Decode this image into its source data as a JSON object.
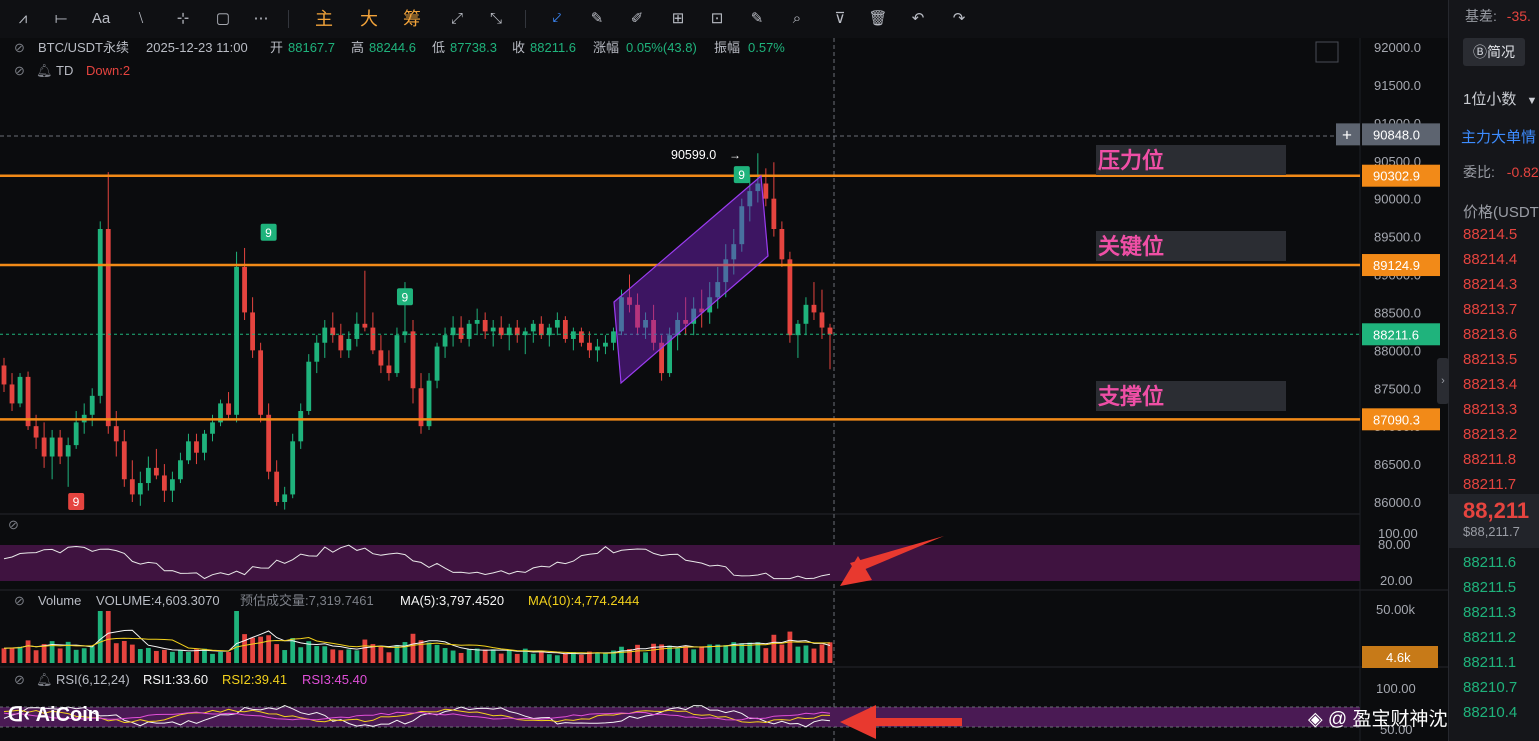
{
  "toolbar": {
    "icons": [
      "wave-line-icon",
      "horizontal-line-icon",
      "text-aa-icon",
      "strike-line-icon",
      "cross-line-icon",
      "rectangle-icon",
      "more-dots-icon"
    ],
    "glyphs": [
      "⩘",
      "⟝",
      "Aa",
      "⧵",
      "⊹",
      "▢",
      "⋯"
    ],
    "cn_buttons": [
      "主",
      "大",
      "筹"
    ],
    "tool_glyphs": [
      "⤢",
      "⤡",
      "⤦",
      "✎",
      "✐",
      "⊞",
      "⊡",
      "✎",
      "⌕",
      "⊽",
      "🗑",
      "↶",
      "↷"
    ]
  },
  "header": {
    "symbol": "BTC/USDT永续",
    "datetime": "2025-12-23 11:00",
    "open_label": "开",
    "open": "88167.7",
    "high_label": "高",
    "high": "88244.6",
    "low_label": "低",
    "low": "87738.3",
    "close_label": "收",
    "close": "88211.6",
    "change_label": "涨幅",
    "change": "0.05%(43.8)",
    "amp_label": "振幅",
    "amp": "0.57%",
    "td_label": "TD",
    "td_down": "Down:2"
  },
  "annotations": {
    "resistance": "压力位",
    "key": "关键位",
    "support": "支撑位",
    "peak": "90599.0"
  },
  "volume_header": {
    "title": "Volume",
    "volume": "VOLUME:4,603.3070",
    "forecast": "预估成交量:7,319.7461",
    "ma5": "MA(5):3,797.4520",
    "ma10": "MA(10):4,774.2444"
  },
  "rsi_header": {
    "title": "RSI(6,12,24)",
    "rsi1": "RSI1:33.60",
    "rsi2": "RSI2:39.41",
    "rsi3": "RSI3:45.40"
  },
  "price_axis": [
    "92000.0",
    "91500.0",
    "91000.0",
    "90500.0",
    "90000.0",
    "89500.0",
    "89000.0",
    "88500.0",
    "88000.0",
    "87500.0",
    "87000.0",
    "86500.0",
    "86000.0"
  ],
  "level_tags": [
    "90848.0",
    "90302.9",
    "89124.9",
    "88211.6",
    "87090.3"
  ],
  "osc_axis": [
    "100.00",
    "80.00",
    "20.00"
  ],
  "vol_axis": [
    "50.00k",
    "4.6k"
  ],
  "rsi_axis": [
    "100.00",
    "50.00"
  ],
  "td_markers": [
    "9",
    "9",
    "9",
    "9"
  ],
  "watermark": {
    "brand": "AiCoin",
    "author": "@ 盈宝财神沈万三"
  },
  "sidebar": {
    "basis_label": "基差:",
    "basis_value": "-35.",
    "brief": "简况",
    "decimals": "1位小数",
    "main_force": "主力大单情",
    "ratio_label": "委比:",
    "ratio_value": "-0.82",
    "price_header": "价格(USDT",
    "asks": [
      "88214.5",
      "88214.4",
      "88214.3",
      "88213.7",
      "88213.6",
      "88213.5",
      "88213.4",
      "88213.3",
      "88213.2",
      "88211.8",
      "88211.7"
    ],
    "last_price": "88,211",
    "last_sub": "$88,211.7",
    "bids": [
      "88211.6",
      "88211.5",
      "88211.3",
      "88211.2",
      "88211.1",
      "88210.7",
      "88210.4"
    ]
  },
  "colors": {
    "up": "#1fb37c",
    "down": "#e5443f",
    "level": "#f28a18",
    "channel": "#8b2fd6",
    "band": "#3f1340",
    "rsi_band": "#4a1a54"
  },
  "chart_data": {
    "type": "candlestick",
    "title": "BTC/USDT永续",
    "ylim": [
      85800,
      92200
    ],
    "horizontal_levels": [
      {
        "label": "压力位",
        "value": 90302.9
      },
      {
        "label": "关键位",
        "value": 89124.9
      },
      {
        "label": "支撑位",
        "value": 87090.3
      }
    ],
    "current_price": 88211.6,
    "crosshair_price": 90848.0,
    "peak": 90599.0,
    "ohlc": [
      [
        87800,
        87900,
        87450,
        87550
      ],
      [
        87550,
        87700,
        87200,
        87300
      ],
      [
        87300,
        87700,
        87250,
        87650
      ],
      [
        87650,
        87720,
        86950,
        87000
      ],
      [
        87000,
        87150,
        86700,
        86850
      ],
      [
        86850,
        87050,
        86450,
        86600
      ],
      [
        86600,
        86950,
        86300,
        86850
      ],
      [
        86850,
        86950,
        86500,
        86600
      ],
      [
        86600,
        86850,
        86200,
        86750
      ],
      [
        86750,
        87200,
        86700,
        87050
      ],
      [
        87050,
        87300,
        86900,
        87150
      ],
      [
        87150,
        87500,
        87000,
        87400
      ],
      [
        87400,
        89700,
        87300,
        89600
      ],
      [
        89600,
        90350,
        86900,
        87000
      ],
      [
        87000,
        87200,
        86600,
        86800
      ],
      [
        86800,
        86950,
        86200,
        86300
      ],
      [
        86300,
        86550,
        86000,
        86100
      ],
      [
        86100,
        86400,
        85950,
        86250
      ],
      [
        86250,
        86600,
        86150,
        86450
      ],
      [
        86450,
        86700,
        86300,
        86350
      ],
      [
        86350,
        86500,
        86000,
        86150
      ],
      [
        86150,
        86400,
        86000,
        86300
      ],
      [
        86300,
        86650,
        86250,
        86550
      ],
      [
        86550,
        86900,
        86500,
        86800
      ],
      [
        86800,
        86900,
        86500,
        86650
      ],
      [
        86650,
        86950,
        86550,
        86900
      ],
      [
        86900,
        87150,
        86800,
        87050
      ],
      [
        87050,
        87350,
        87000,
        87300
      ],
      [
        87300,
        87450,
        87100,
        87150
      ],
      [
        87150,
        89300,
        87050,
        89100
      ],
      [
        89100,
        89350,
        88400,
        88500
      ],
      [
        88500,
        88700,
        87900,
        88000
      ],
      [
        88000,
        88100,
        87050,
        87150
      ],
      [
        87150,
        87300,
        86300,
        86400
      ],
      [
        86400,
        86550,
        85950,
        86000
      ],
      [
        86000,
        86200,
        85900,
        86100
      ],
      [
        86100,
        86900,
        86050,
        86800
      ],
      [
        86800,
        87300,
        86700,
        87200
      ],
      [
        87200,
        87950,
        87150,
        87850
      ],
      [
        87850,
        88200,
        87700,
        88100
      ],
      [
        88100,
        88400,
        87900,
        88300
      ],
      [
        88300,
        88500,
        88100,
        88200
      ],
      [
        88200,
        88350,
        87900,
        88000
      ],
      [
        88000,
        88250,
        87900,
        88150
      ],
      [
        88150,
        88500,
        88050,
        88350
      ],
      [
        88350,
        89050,
        88250,
        88300
      ],
      [
        88300,
        88500,
        87950,
        88000
      ],
      [
        88000,
        88200,
        87700,
        87800
      ],
      [
        87800,
        88000,
        87600,
        87700
      ],
      [
        87700,
        88300,
        87650,
        88200
      ],
      [
        88200,
        88900,
        88100,
        88250
      ],
      [
        88250,
        88400,
        87300,
        87500
      ],
      [
        87500,
        87700,
        86900,
        87000
      ],
      [
        87000,
        87700,
        86950,
        87600
      ],
      [
        87600,
        88100,
        87500,
        88050
      ],
      [
        88050,
        88300,
        87900,
        88200
      ],
      [
        88200,
        88450,
        88050,
        88300
      ],
      [
        88300,
        88450,
        88100,
        88150
      ],
      [
        88150,
        88400,
        88050,
        88350
      ],
      [
        88350,
        88550,
        88200,
        88400
      ],
      [
        88400,
        88500,
        88150,
        88250
      ],
      [
        88250,
        88400,
        88050,
        88300
      ],
      [
        88300,
        88450,
        88150,
        88200
      ],
      [
        88200,
        88350,
        88000,
        88300
      ],
      [
        88300,
        88400,
        88100,
        88200
      ],
      [
        88200,
        88300,
        87950,
        88250
      ],
      [
        88250,
        88400,
        88100,
        88350
      ],
      [
        88350,
        88450,
        88150,
        88200
      ],
      [
        88200,
        88350,
        88050,
        88300
      ],
      [
        88300,
        88500,
        88200,
        88400
      ],
      [
        88400,
        88450,
        88100,
        88150
      ],
      [
        88150,
        88300,
        88000,
        88250
      ],
      [
        88250,
        88300,
        88050,
        88100
      ],
      [
        88100,
        88250,
        87900,
        88000
      ],
      [
        88000,
        88150,
        87850,
        88050
      ],
      [
        88050,
        88200,
        87950,
        88100
      ],
      [
        88100,
        88300,
        88000,
        88250
      ],
      [
        88250,
        88800,
        88200,
        88700
      ],
      [
        88700,
        89000,
        88500,
        88600
      ],
      [
        88600,
        88750,
        88200,
        88300
      ],
      [
        88300,
        88500,
        88150,
        88400
      ],
      [
        88400,
        88600,
        88000,
        88100
      ],
      [
        88100,
        88200,
        87600,
        87700
      ],
      [
        87700,
        88300,
        87650,
        88200
      ],
      [
        88200,
        88500,
        88000,
        88400
      ],
      [
        88400,
        88700,
        88200,
        88350
      ],
      [
        88350,
        88700,
        88200,
        88550
      ],
      [
        88550,
        88800,
        88300,
        88500
      ],
      [
        88500,
        88900,
        88350,
        88700
      ],
      [
        88700,
        89100,
        88550,
        88900
      ],
      [
        88900,
        89400,
        88700,
        89200
      ],
      [
        89200,
        89600,
        89000,
        89400
      ],
      [
        89400,
        90000,
        89300,
        89900
      ],
      [
        89900,
        90300,
        89700,
        90100
      ],
      [
        90100,
        90599,
        89950,
        90200
      ],
      [
        90200,
        90400,
        89900,
        90000
      ],
      [
        90000,
        90480,
        89500,
        89600
      ],
      [
        89600,
        89700,
        89100,
        89200
      ],
      [
        89200,
        89300,
        88100,
        88200
      ],
      [
        88200,
        88400,
        87900,
        88350
      ],
      [
        88350,
        88700,
        88200,
        88600
      ],
      [
        88600,
        88900,
        88400,
        88500
      ],
      [
        88500,
        88800,
        88150,
        88300
      ],
      [
        88300,
        88350,
        87750,
        88212
      ]
    ],
    "volume": {
      "ma5": 3797.452,
      "ma10": 4774.2444,
      "last": 4603.307,
      "ylim": [
        0,
        60000
      ]
    },
    "rsi": {
      "rsi1": 33.6,
      "rsi2": 39.41,
      "rsi3": 45.4,
      "ylim": [
        0,
        100
      ]
    }
  }
}
